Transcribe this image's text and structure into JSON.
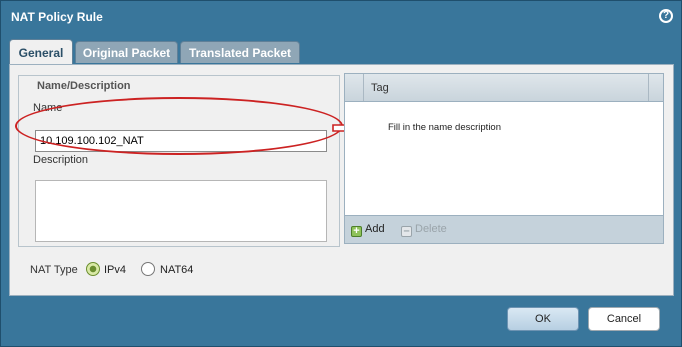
{
  "dialog": {
    "title": "NAT Policy Rule",
    "help": "?"
  },
  "tabs": [
    {
      "label": "General",
      "active": true
    },
    {
      "label": "Original Packet",
      "active": false
    },
    {
      "label": "Translated Packet",
      "active": false
    }
  ],
  "name_section": {
    "legend": "Name/Description",
    "name_label": "Name",
    "name_value": "10.109.100.102_NAT",
    "description_label": "Description",
    "description_value": ""
  },
  "annotation": {
    "note": "Fill in the name description",
    "color": "#cc2222"
  },
  "tags": {
    "header": "Tag",
    "add_label": "Add",
    "delete_label": "Delete"
  },
  "nat_type": {
    "label": "NAT Type",
    "options": [
      {
        "label": "IPv4",
        "selected": true
      },
      {
        "label": "NAT64",
        "selected": false
      }
    ]
  },
  "buttons": {
    "ok": "OK",
    "cancel": "Cancel"
  }
}
